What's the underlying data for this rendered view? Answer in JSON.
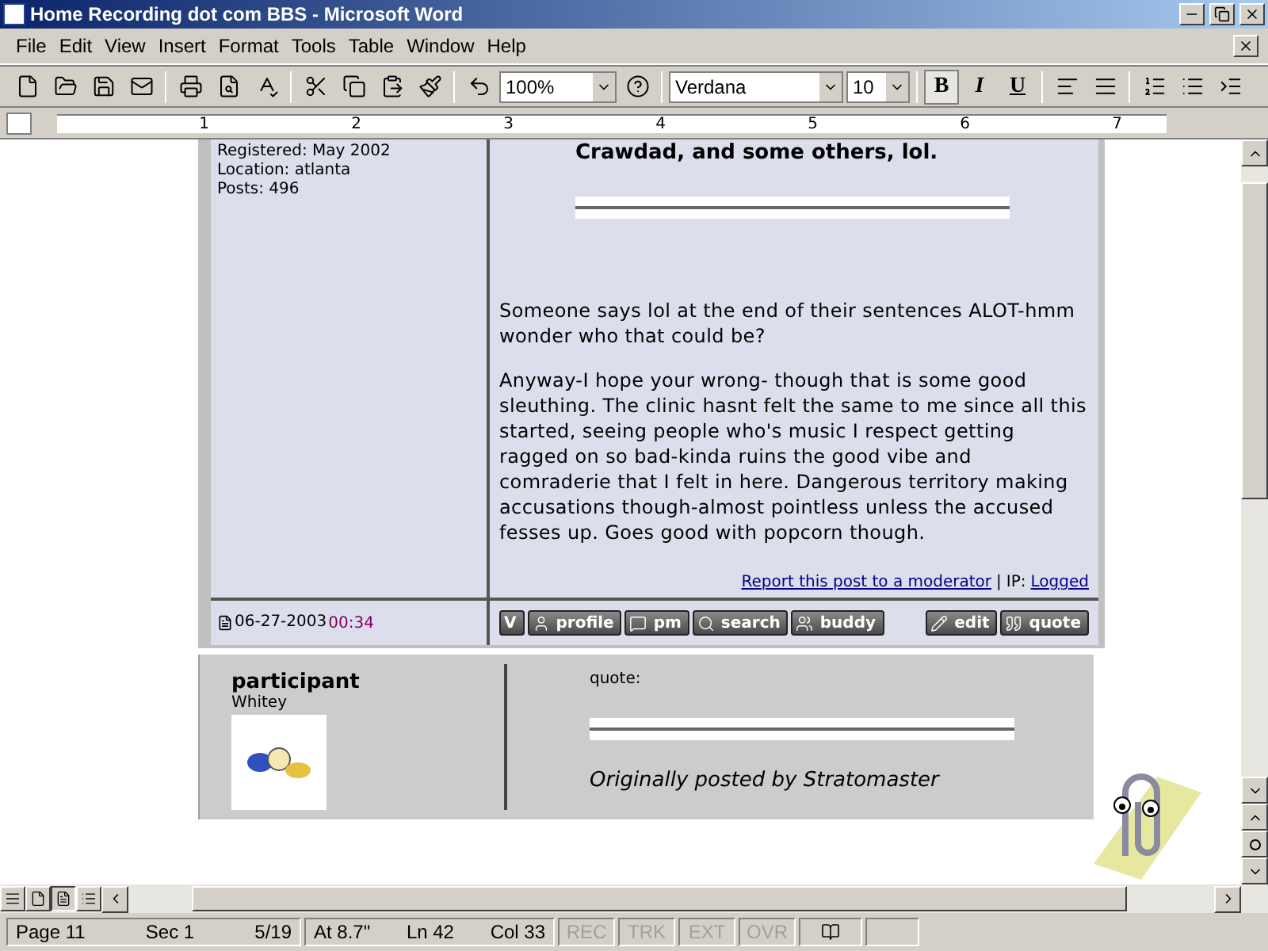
{
  "window": {
    "title": "Home Recording dot com BBS - Microsoft Word"
  },
  "menu": [
    "File",
    "Edit",
    "View",
    "Insert",
    "Format",
    "Tools",
    "Table",
    "Window",
    "Help"
  ],
  "toolbar": {
    "zoom": "100%",
    "font": "Verdana",
    "size": "10",
    "format_buttons": [
      {
        "kind": "bold",
        "label": "B",
        "selected": true
      },
      {
        "kind": "italic",
        "label": "I",
        "selected": false
      },
      {
        "kind": "underline",
        "label": "U",
        "selected": false
      }
    ]
  },
  "ruler": {
    "numbers": [
      "1",
      "2",
      "3",
      "4",
      "5",
      "6",
      "7"
    ]
  },
  "post": {
    "profile": [
      "Registered: May 2002",
      "Location: atlanta",
      "Posts: 496"
    ],
    "quote_text": "Crawdad, and some others, lol.",
    "paragraphs": [
      "Someone says lol at the end of their sentences ALOT-hmm wonder who that could be?",
      "Anyway-I hope your wrong- though that is some good sleuthing. The clinic hasnt felt the same to me since all this started, seeing people who's music I respect getting ragged on so bad-kinda ruins the good vibe and comraderie that I felt in here. Dangerous territory making accusations though-almost pointless unless the accused fesses up. Goes good with popcorn though."
    ],
    "report_link": "Report this post to a moderator",
    "separator": "|",
    "ip_label": "IP:",
    "ip_link": "Logged",
    "date": "06-27-2003",
    "time": "00:34",
    "buttons": [
      {
        "kind": "v",
        "label": "V"
      },
      {
        "kind": "profile",
        "label": "profile"
      },
      {
        "kind": "pm",
        "label": "pm"
      },
      {
        "kind": "search",
        "label": "search"
      },
      {
        "kind": "buddy",
        "label": "buddy"
      }
    ],
    "edit_buttons": [
      {
        "kind": "edit",
        "label": "edit"
      },
      {
        "kind": "quote",
        "label": "quote"
      }
    ]
  },
  "next_post": {
    "username": "participant",
    "rank": "Whitey",
    "quote_label": "quote:",
    "quote_attribution": "Originally posted by Stratomaster"
  },
  "status_bar": {
    "fields": [
      {
        "items": [
          "Page 11",
          "Sec 1",
          "5/19"
        ]
      },
      {
        "items": [
          "At 8.7\"",
          "Ln 42",
          "Col 33"
        ]
      }
    ],
    "modes": [
      {
        "label": "REC",
        "disabled": true
      },
      {
        "label": "TRK",
        "disabled": true
      },
      {
        "label": "EXT",
        "disabled": true
      },
      {
        "label": "OVR",
        "disabled": true
      }
    ]
  }
}
